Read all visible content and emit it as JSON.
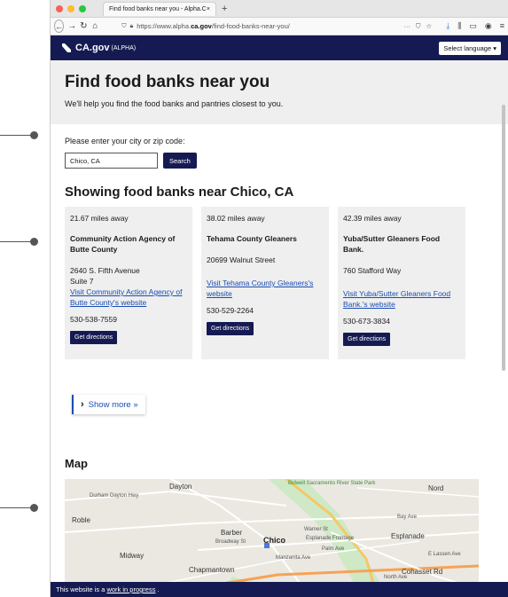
{
  "browser": {
    "tab_title": "Find food banks near you - Alpha.C",
    "tab_close": "×",
    "new_tab": "+",
    "url_prefix": "https://www.alpha.",
    "url_domain": "ca.gov",
    "url_path": "/find-food-banks-near-you/",
    "url_more": "···"
  },
  "header": {
    "logo_text": "CA.gov",
    "logo_sup": "(ALPHA)",
    "language_button": "Select language ▾"
  },
  "hero": {
    "title": "Find food banks near you",
    "subtitle": "We'll help you find the food banks and pantries closest to you."
  },
  "search": {
    "label": "Please enter your city or zip code:",
    "value": "Chico, CA",
    "button": "Search"
  },
  "results": {
    "heading": "Showing food banks near Chico, CA",
    "cards": [
      {
        "distance": "21.67 miles away",
        "name": "Community Action Agency of Butte County",
        "address_line1": "2640 S. Fifth Avenue",
        "address_line2": "Suite 7",
        "link": "Visit Community Action Agency of Butte County's website",
        "phone": "530-538-7559",
        "button": "Get directions"
      },
      {
        "distance": "38.02 miles away",
        "name": "Tehama County Gleaners",
        "address_line1": "20699 Walnut Street",
        "address_line2": "",
        "link": "Visit Tehama County Gleaners's website",
        "phone": "530-529-2264",
        "button": "Get directions"
      },
      {
        "distance": "42.39 miles away",
        "name": "Yuba/Sutter Gleaners Food Bank.",
        "address_line1": "760 Stafford Way",
        "address_line2": "",
        "link": "Visit Yuba/Sutter Gleaners Food Bank.'s website",
        "phone": "530-673-3834",
        "button": "Get directions"
      }
    ],
    "show_more": "Show more »"
  },
  "map": {
    "title": "Map",
    "labels": [
      "Dayton",
      "Bidwell Sacramento River State Park",
      "Nord",
      "Durham Dayton Hwy",
      "Roble",
      "Barber",
      "Chico",
      "Esplanade",
      "Midway",
      "Chapmantown",
      "North Ave",
      "Cohasset Rd",
      "E Lassen Ave",
      "Bay Ave",
      "Esplanade Frontage",
      "Palm Ave",
      "Broadway St",
      "Manzanita Ave",
      "Warner St"
    ]
  },
  "footer": {
    "text_before": "This website is a",
    "link": "work in progress",
    "text_after": "."
  },
  "colors": {
    "brand_navy": "#151b52",
    "link_blue": "#1a4db3",
    "panel_gray": "#efefef"
  }
}
